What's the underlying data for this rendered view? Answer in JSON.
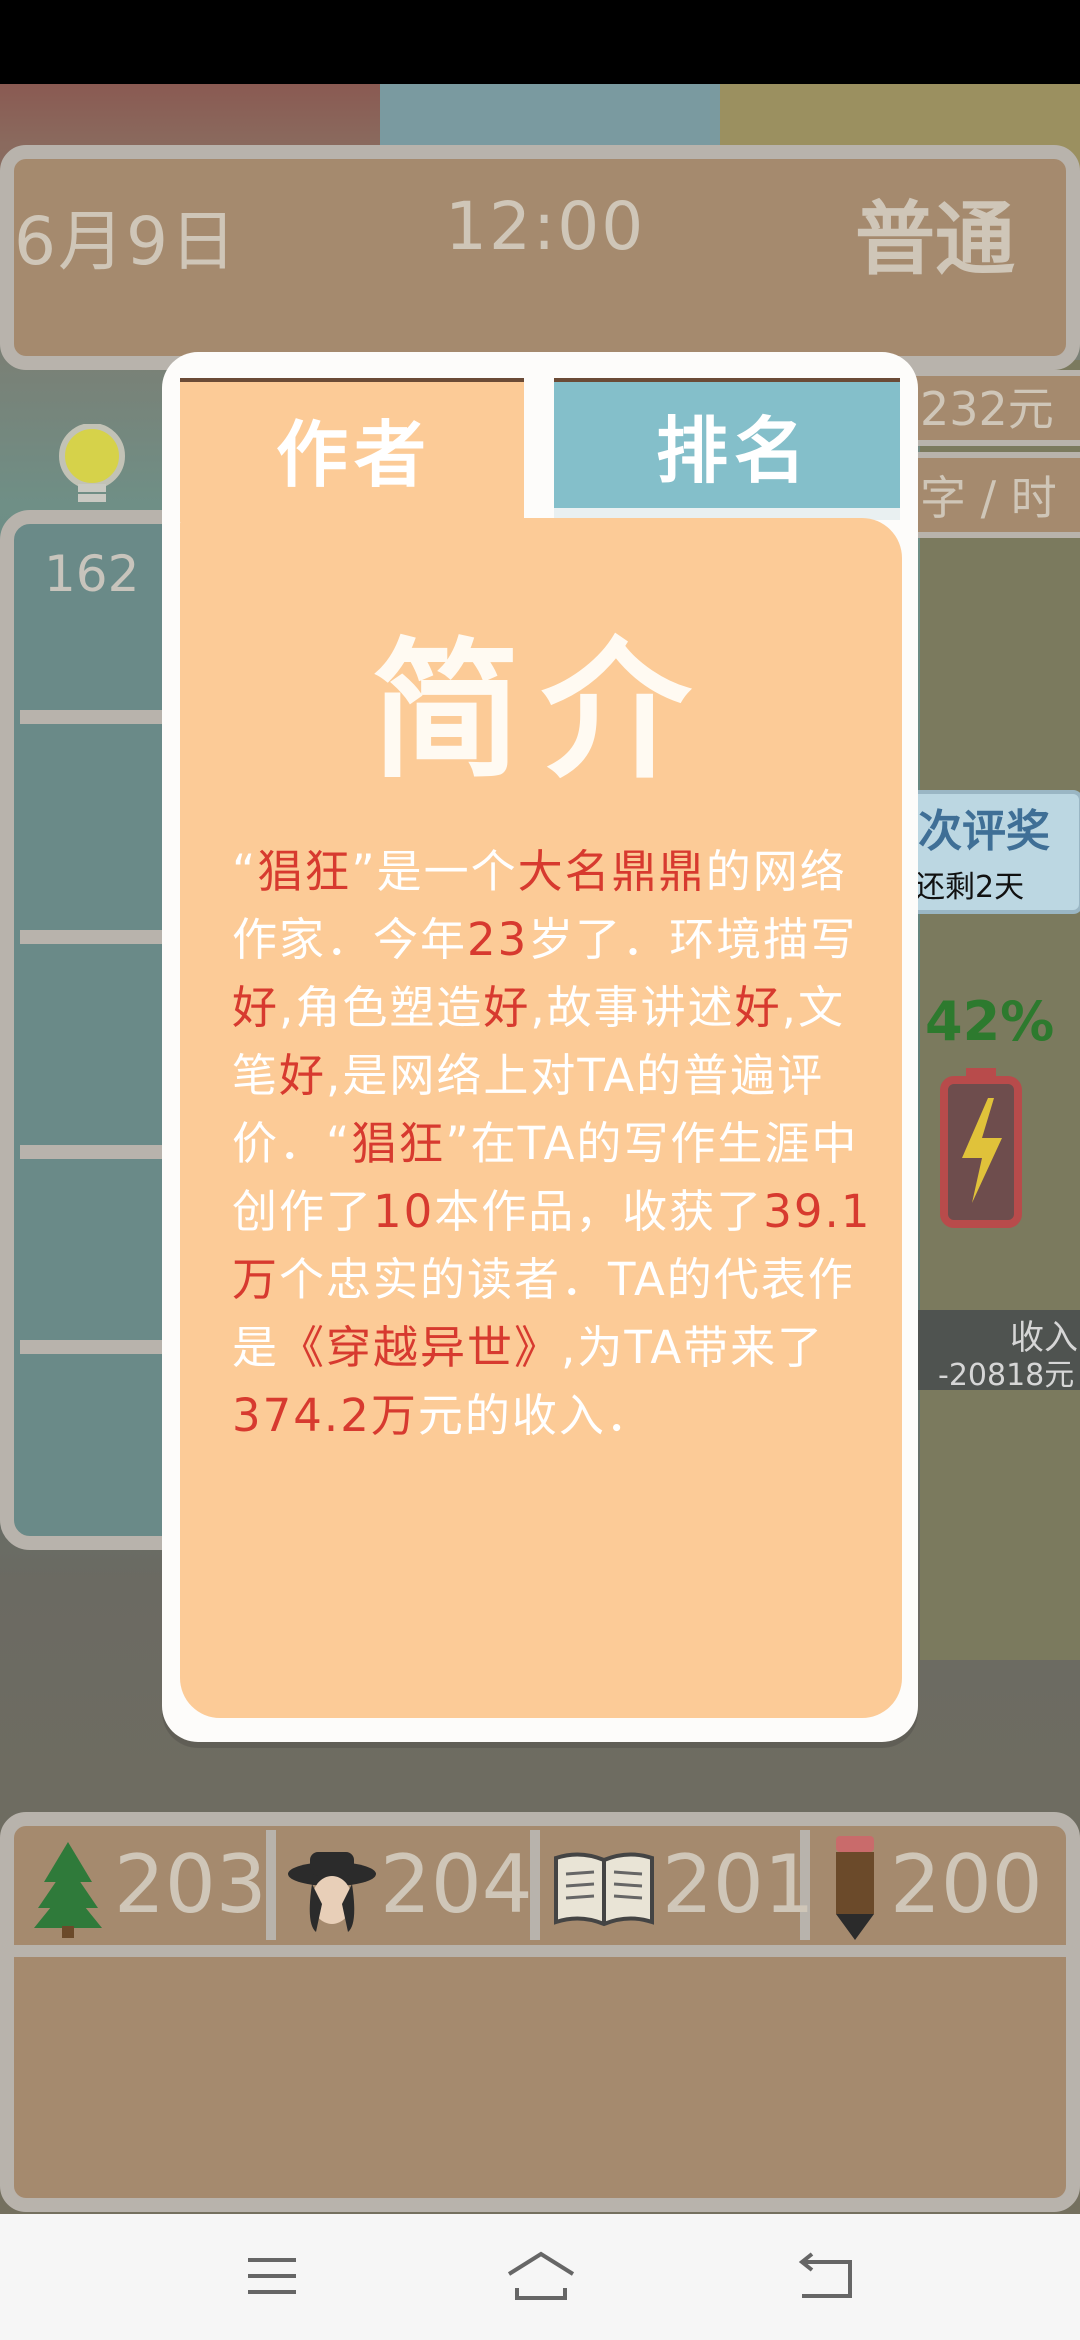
{
  "hud": {
    "date": "6月9日",
    "time": "12:00",
    "mode": "普通",
    "money": "232元",
    "speed": "字 / 时",
    "left_number": "162",
    "award_title": "次评奖",
    "award_sub": "还剩2天",
    "percent": "42%",
    "income_label": "收入",
    "income_value": "-20818元"
  },
  "tabs": {
    "author": "作者",
    "rank": "排名"
  },
  "card": {
    "title": "简介",
    "segments": [
      {
        "text": "“",
        "hl": false
      },
      {
        "text": "猖狂",
        "hl": true
      },
      {
        "text": "”是一个",
        "hl": false
      },
      {
        "text": "大名鼎鼎",
        "hl": true
      },
      {
        "text": "的网络作家．今年",
        "hl": false
      },
      {
        "text": "23",
        "hl": true
      },
      {
        "text": "岁了．环境描写",
        "hl": false
      },
      {
        "text": "好",
        "hl": true
      },
      {
        "text": ",角色塑造",
        "hl": false
      },
      {
        "text": "好",
        "hl": true
      },
      {
        "text": ",故事讲述",
        "hl": false
      },
      {
        "text": "好",
        "hl": true
      },
      {
        "text": ",文笔",
        "hl": false
      },
      {
        "text": "好",
        "hl": true
      },
      {
        "text": ",是网络上对TA的普遍评价．“",
        "hl": false
      },
      {
        "text": "猖狂",
        "hl": true
      },
      {
        "text": "”在TA的写作生涯中创作了",
        "hl": false
      },
      {
        "text": "10",
        "hl": true
      },
      {
        "text": "本作品，收获了",
        "hl": false
      },
      {
        "text": "39.1万",
        "hl": true
      },
      {
        "text": "个忠实的读者．TA的代表作是",
        "hl": false
      },
      {
        "text": "《穿越异世》",
        "hl": true
      },
      {
        "text": ",为TA带来了",
        "hl": false
      },
      {
        "text": "374.2万",
        "hl": true
      },
      {
        "text": "元的收入．",
        "hl": false
      }
    ]
  },
  "stats": [
    {
      "icon": "tree-icon",
      "value": "203"
    },
    {
      "icon": "hat-person-icon",
      "value": "204"
    },
    {
      "icon": "book-icon",
      "value": "201"
    },
    {
      "icon": "pencil-icon",
      "value": "200"
    }
  ],
  "nav": {
    "menu": "menu-icon",
    "home": "home-icon",
    "back": "back-icon"
  },
  "colors": {
    "highlight": "#d73a2f",
    "card": "#fccb97",
    "rank_tab": "#84bfca"
  }
}
